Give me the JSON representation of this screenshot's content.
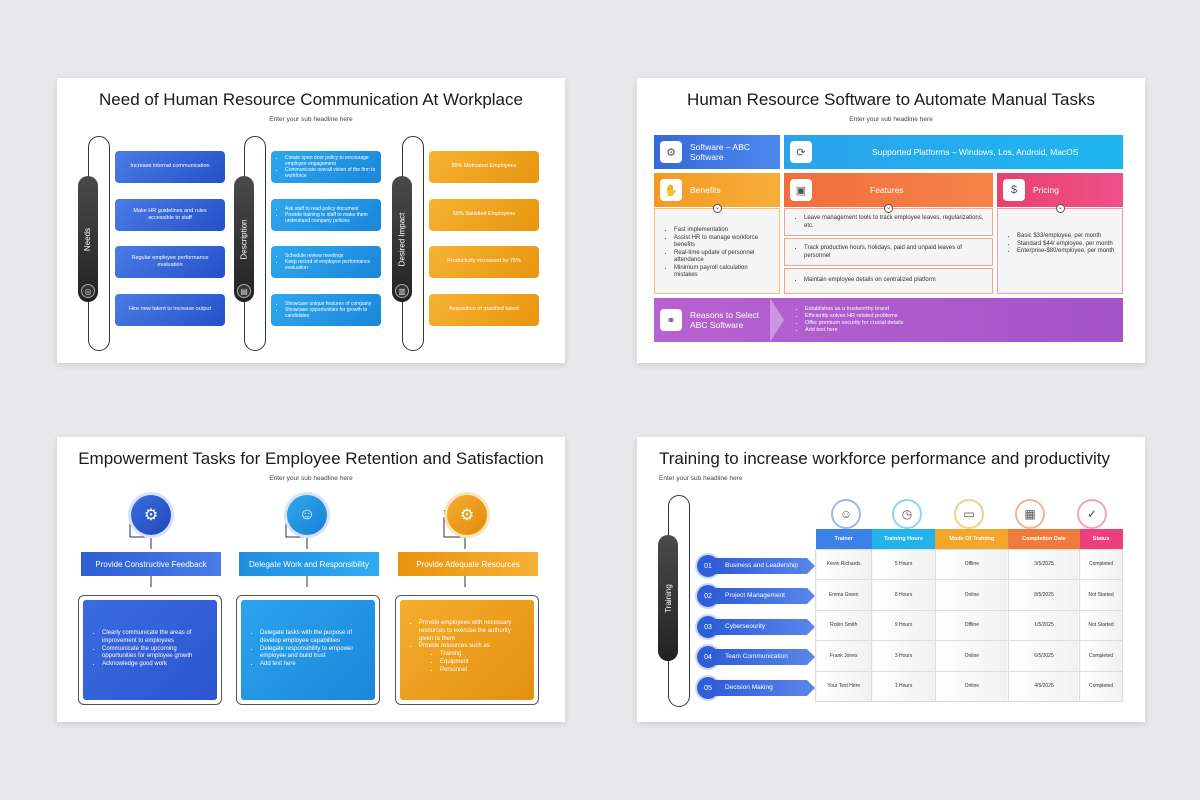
{
  "subtitle": "Enter your sub headline here",
  "s1": {
    "title": "Need of Human Resource Communication At Workplace",
    "rails": [
      "Needs",
      "Description",
      "Desired Impact"
    ],
    "needs": [
      "Increase internal communication",
      "Make HR guidelines and rules accessible to staff",
      "Regular employee performance evaluation",
      "Hire new talent to increase output"
    ],
    "desc": [
      [
        "Create open door policy to encourage employee engagement",
        "Communicate overall vision of the firm to workforce"
      ],
      [
        "Ask staff to read policy document",
        "Provide training to staff to make them understand company policies"
      ],
      [
        "Schedule review meetings",
        "Keep record of employee performance evaluation"
      ],
      [
        "Showcase unique features of company",
        "Showcase opportunities for growth to candidates"
      ]
    ],
    "impact": [
      "99% Motivated Employees",
      "66% Satisfied Employees",
      "Productivity increased by 75%",
      "Acquisition of qualified talent"
    ]
  },
  "s2": {
    "title": "Human Resource Software to Automate Manual Tasks",
    "software": "Software – ABC Software",
    "platforms": "Supported Platforms – Windows, Los, Android, MacOS",
    "benefits": "Benefits",
    "features": "Features",
    "pricing": "Pricing",
    "benefit_items": [
      "Fast implementation",
      "Assist HR to manage workforce benefits",
      "Real-time update of personnel attendance",
      "Minimum payroll calculation mistakes"
    ],
    "feature_items": [
      "Leave management tools to track employee leaves, regularizations, etc.",
      "Track productive hours, holidays, paid and unpaid leaves of personnel",
      "Maintain employee details on centralized platform"
    ],
    "pricing_items": [
      "Basic $33/employee, per month",
      "Standard $44/ employee, per month",
      "Enterprise-$80/employee, per month"
    ],
    "reasons": "Reasons to Select ABC Software",
    "reason_items": [
      "Establishes as a trustworthy brand",
      "Efficiently solves HR related problems",
      "Offer premium security for crucial details",
      "Add text here"
    ]
  },
  "s3": {
    "title": "Empowerment Tasks for Employee Retention and Satisfaction",
    "headers": [
      "Provide Constructive Feedback",
      "Delegate Work and Responsibility",
      "Provide Adequate Resources"
    ],
    "col1": [
      "Clearly communicate the areas of improvement to employees",
      "Communicate the upcoming opportunities for employee growth",
      "Acknowledge good work"
    ],
    "col2": [
      "Delegate tasks with the purpose of develop employee capabilities",
      "Delegate responsibility to empower employee and build trust",
      "Add text here"
    ],
    "col3": [
      "Provide employees with necessary resources to exercise the authority given to them",
      "Provide resources  such as"
    ],
    "col3_sub": [
      "Training",
      "Equipment",
      "Personnel"
    ]
  },
  "s4": {
    "title": "Training to increase workforce performance and productivity",
    "rail": "Training",
    "rows": [
      {
        "n": "01",
        "label": "Business and Leadership"
      },
      {
        "n": "02",
        "label": "Project Management"
      },
      {
        "n": "03",
        "label": "Cyberseourity"
      },
      {
        "n": "04",
        "label": "Team Communication"
      },
      {
        "n": "05",
        "label": "Decision Making"
      }
    ],
    "headers": [
      "Trainer",
      "Training Hours",
      "Mode Of Training",
      "Completion Date",
      "Status"
    ],
    "header_colors": [
      "#3b82e8",
      "#21b3e9",
      "#f3a62a",
      "#f07a3c",
      "#ec3f7c"
    ],
    "table": [
      [
        "Kevin Richards",
        "5 Hours",
        "Offline",
        "3/5/2025",
        "Completed"
      ],
      [
        "Emma Green",
        "8 Hours",
        "Online",
        "8/5/2025",
        "Not Started"
      ],
      [
        "Robin Smith",
        "9 Hours",
        "Offline",
        "1/5/2025",
        "Not Started"
      ],
      [
        "Frank Jones",
        "3 Hours",
        "Online",
        "6/5/2025",
        "Completed"
      ],
      [
        "Your Text Here",
        "1 Hours",
        "Online",
        "4/5/2025",
        "Completed"
      ]
    ]
  }
}
